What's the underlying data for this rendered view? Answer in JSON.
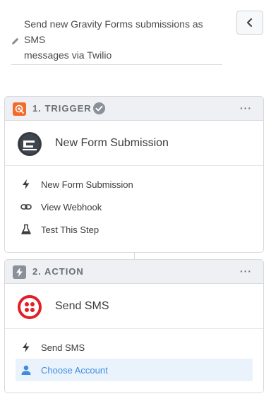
{
  "header": {
    "title_lines": [
      "Send new Gravity Forms submissions as",
      "SMS",
      "messages via Twilio"
    ],
    "back_icon": "chevron-left-icon",
    "edit_icon": "pencil-icon"
  },
  "trigger": {
    "step_label": "1. TRIGGER",
    "more_label": "···",
    "app_title": "New Form Submission",
    "app_logo": "gravity-forms-logo",
    "items": [
      {
        "label": "New Form Submission",
        "icon": "bolt-icon"
      },
      {
        "label": "View Webhook",
        "icon": "link-icon"
      },
      {
        "label": "Test This Step",
        "icon": "flask-icon"
      }
    ],
    "accent": "#f26b2b"
  },
  "action": {
    "step_label": "2. ACTION",
    "more_label": "···",
    "app_title": "Send SMS",
    "app_logo": "twilio-logo",
    "items": [
      {
        "label": "Send SMS",
        "icon": "bolt-icon"
      },
      {
        "label": "Choose Account",
        "icon": "user-icon"
      }
    ],
    "accent": "#8a9099",
    "twilio_red": "#e31e26",
    "active_color": "#3f8ce0"
  }
}
